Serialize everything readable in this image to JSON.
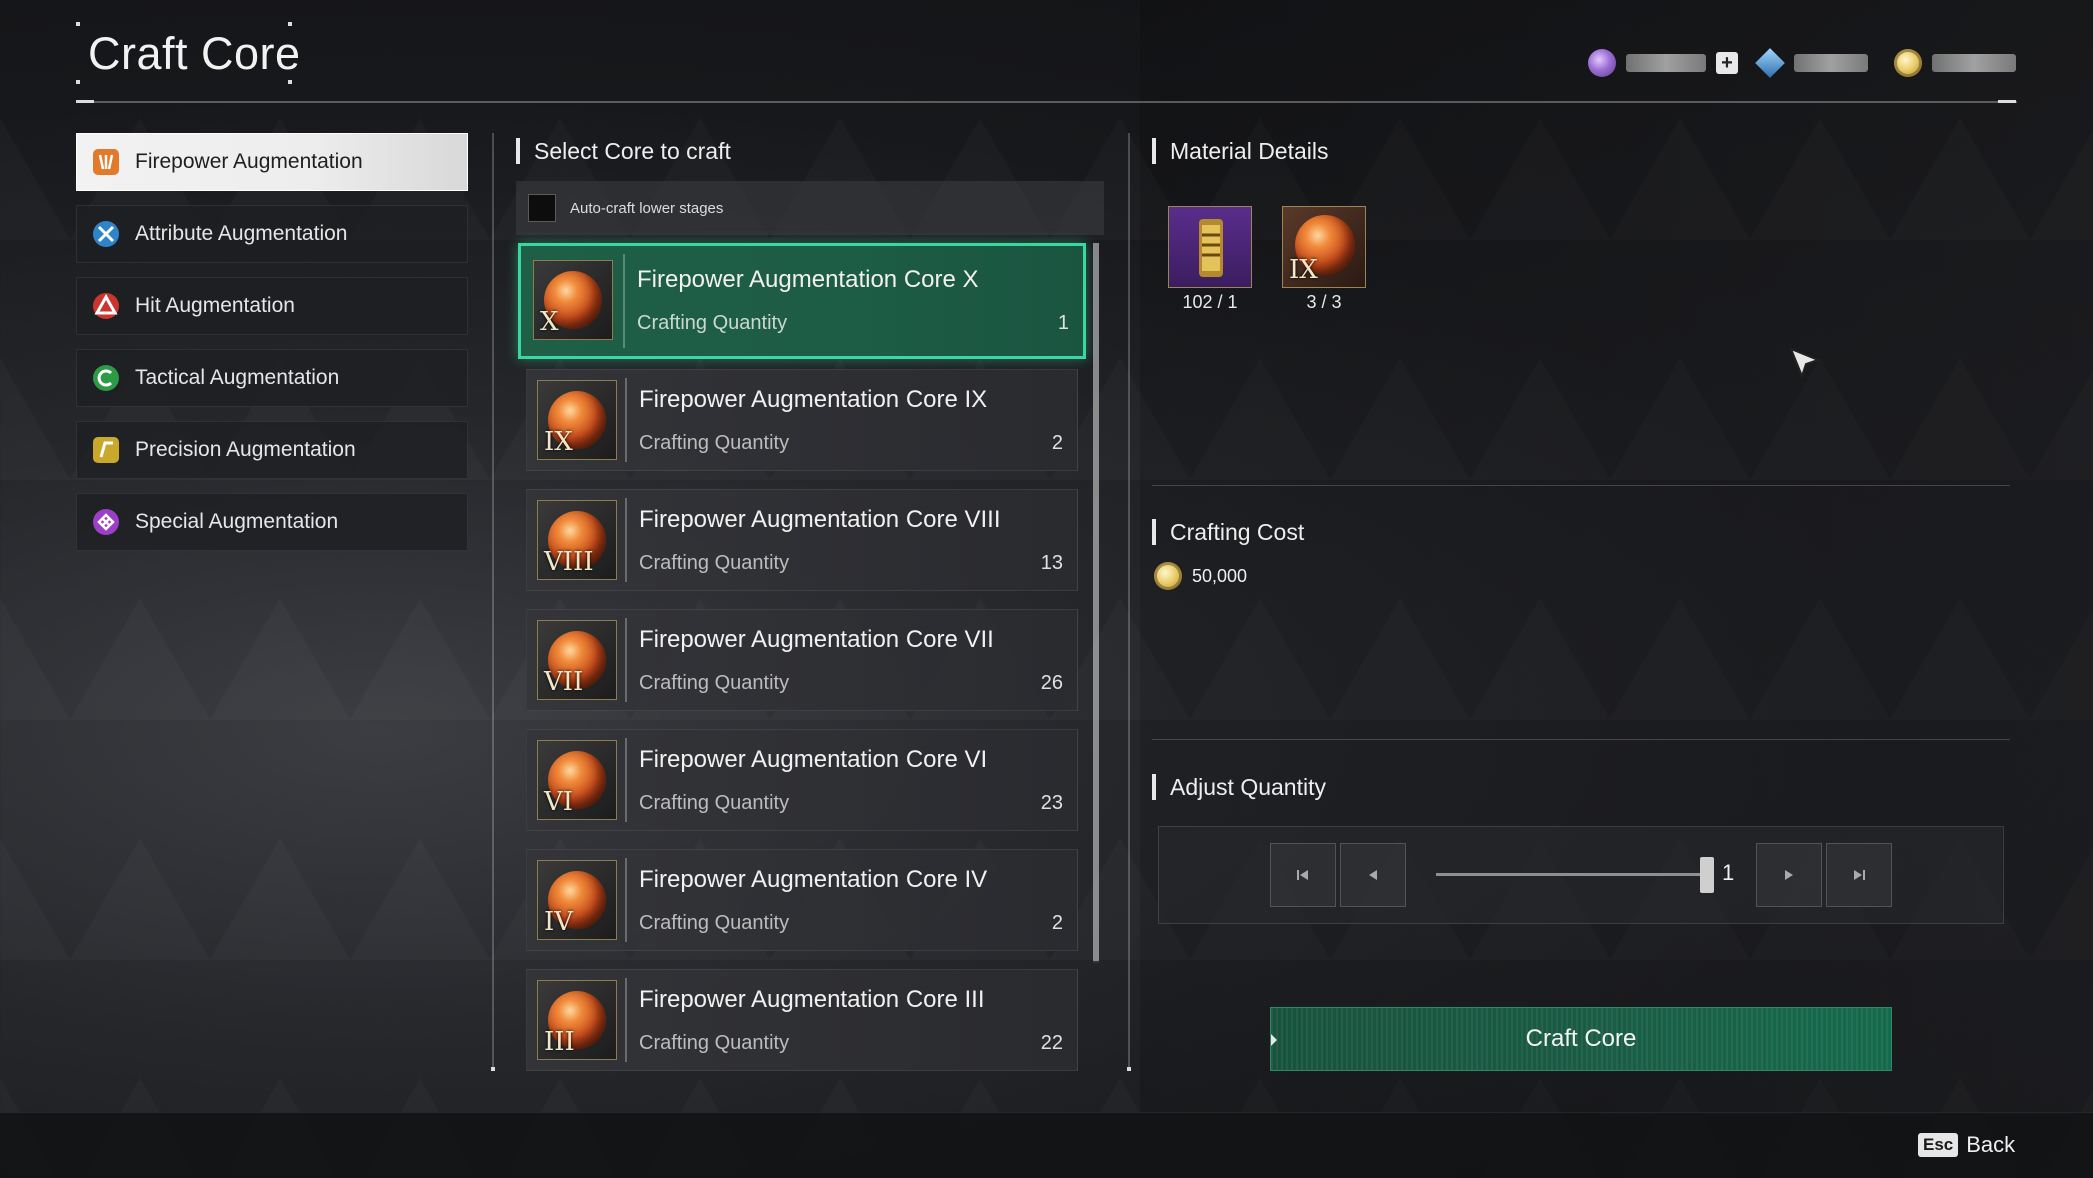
{
  "header": {
    "title": "Craft Core"
  },
  "currencies": [
    {
      "icon": "purple-gem-icon",
      "has_add": true
    },
    {
      "icon": "crystal-icon",
      "has_add": false
    },
    {
      "icon": "gold-coin-icon",
      "has_add": false
    }
  ],
  "categories": [
    {
      "label": "Firepower Augmentation",
      "icon": "firepower-icon",
      "active": true
    },
    {
      "label": "Attribute Augmentation",
      "icon": "attribute-icon",
      "active": false
    },
    {
      "label": "Hit Augmentation",
      "icon": "hit-icon",
      "active": false
    },
    {
      "label": "Tactical Augmentation",
      "icon": "tactical-icon",
      "active": false
    },
    {
      "label": "Precision Augmentation",
      "icon": "precision-icon",
      "active": false
    },
    {
      "label": "Special Augmentation",
      "icon": "special-icon",
      "active": false
    }
  ],
  "select_core": {
    "heading": "Select Core to craft",
    "auto_craft_label": "Auto-craft lower stages",
    "auto_craft_checked": false,
    "cores": [
      {
        "name": "Firepower Augmentation Core X",
        "numeral": "X",
        "qty_label": "Crafting Quantity",
        "qty": "1",
        "selected": true
      },
      {
        "name": "Firepower Augmentation Core IX",
        "numeral": "IX",
        "qty_label": "Crafting Quantity",
        "qty": "2",
        "selected": false
      },
      {
        "name": "Firepower Augmentation Core VIII",
        "numeral": "VIII",
        "qty_label": "Crafting Quantity",
        "qty": "13",
        "selected": false
      },
      {
        "name": "Firepower Augmentation Core VII",
        "numeral": "VII",
        "qty_label": "Crafting Quantity",
        "qty": "26",
        "selected": false
      },
      {
        "name": "Firepower Augmentation Core VI",
        "numeral": "VI",
        "qty_label": "Crafting Quantity",
        "qty": "23",
        "selected": false
      },
      {
        "name": "Firepower Augmentation Core IV",
        "numeral": "IV",
        "qty_label": "Crafting Quantity",
        "qty": "2",
        "selected": false
      },
      {
        "name": "Firepower Augmentation Core III",
        "numeral": "III",
        "qty_label": "Crafting Quantity",
        "qty": "22",
        "selected": false
      }
    ]
  },
  "material_details": {
    "heading": "Material Details",
    "items": [
      {
        "icon": "barrel-material-icon",
        "count": "102 / 1"
      },
      {
        "icon": "core-ix-material-icon",
        "numeral": "IX",
        "count": "3 / 3"
      }
    ]
  },
  "crafting_cost": {
    "heading": "Crafting Cost",
    "amount": "50,000",
    "icon": "gold-coin-icon"
  },
  "adjust_quantity": {
    "heading": "Adjust Quantity",
    "value": "1",
    "slider_level": 1.0
  },
  "craft_button": {
    "label": "Craft Core"
  },
  "footer": {
    "esc_key": "Esc",
    "back_label": "Back"
  }
}
